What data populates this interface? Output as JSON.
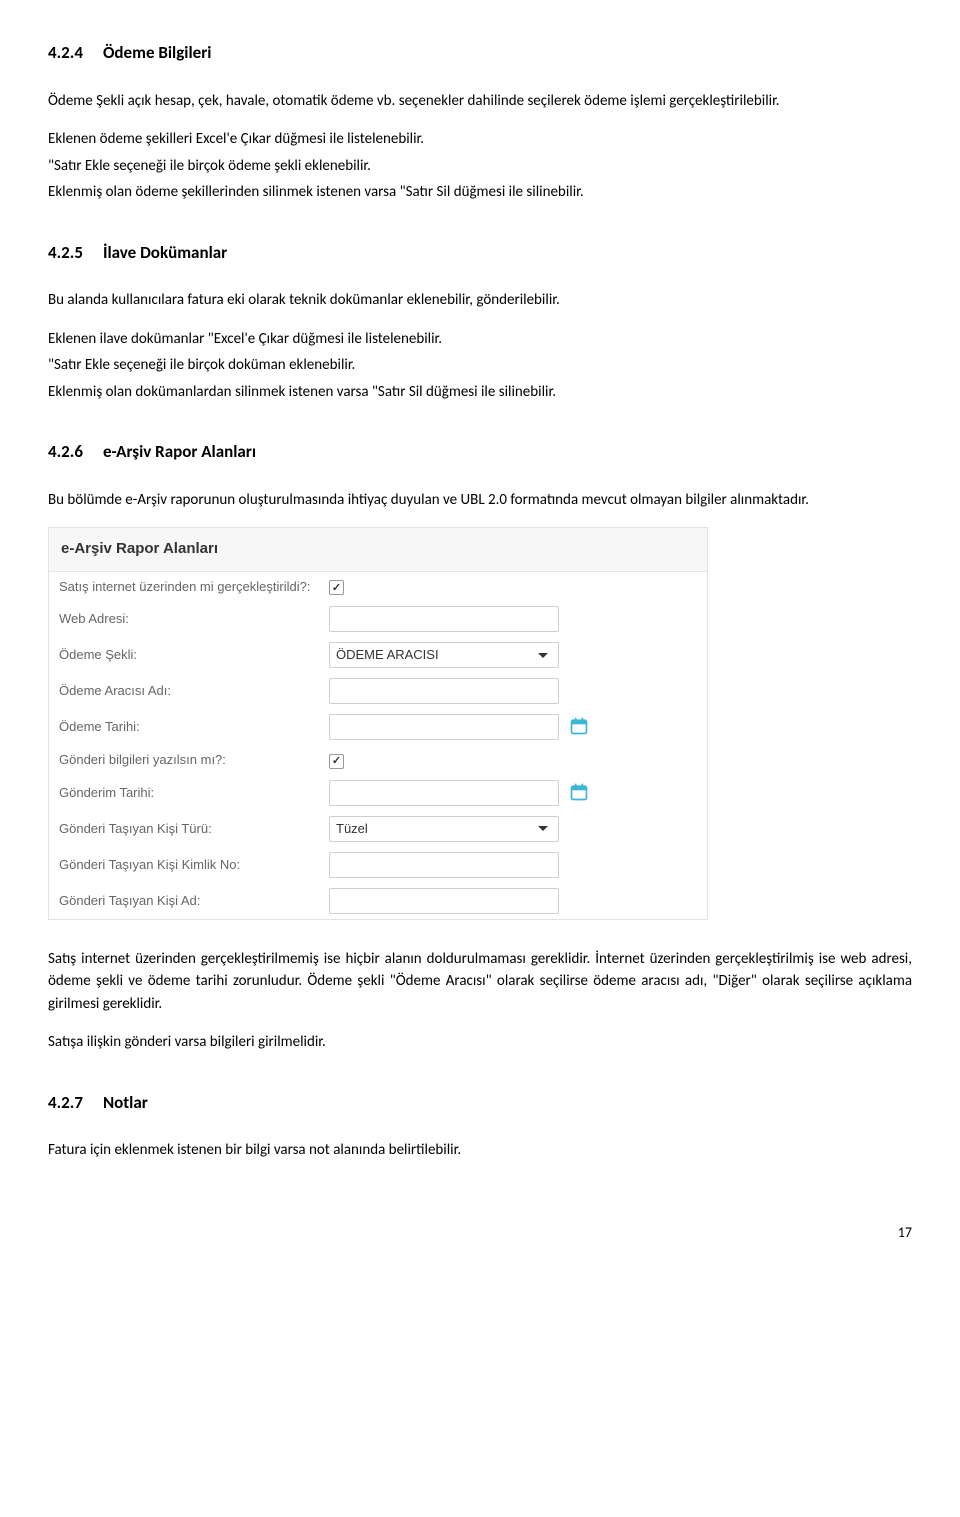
{
  "sections": {
    "s424": {
      "num": "4.2.4",
      "title": "Ödeme Bilgileri"
    },
    "s425": {
      "num": "4.2.5",
      "title": "İlave Dokümanlar"
    },
    "s426": {
      "num": "4.2.6",
      "title": "e-Arşiv Rapor Alanları"
    },
    "s427": {
      "num": "4.2.7",
      "title": "Notlar"
    }
  },
  "para": {
    "p424_1": "Ödeme Şekli açık hesap, çek, havale, otomatik ödeme vb. seçenekler dahilinde seçilerek ödeme işlemi gerçekleştirilebilir.",
    "p424_2": "Eklenen ödeme şekilleri Excel'e Çıkar düğmesi ile listelenebilir.",
    "p424_3": "\"Satır Ekle seçeneği ile birçok ödeme şekli eklenebilir.",
    "p424_4": "Eklenmiş olan ödeme şekillerinden silinmek istenen varsa \"Satır Sil düğmesi ile silinebilir.",
    "p425_1": "Bu alanda kullanıcılara  fatura eki olarak teknik  dokümanlar eklenebilir, gönderilebilir.",
    "p425_2": "Eklenen ilave dokümanlar \"Excel'e Çıkar düğmesi ile listelenebilir.",
    "p425_3": "\"Satır Ekle seçeneği ile birçok doküman eklenebilir.",
    "p425_4": "Eklenmiş olan dokümanlardan silinmek istenen varsa \"Satır Sil düğmesi ile silinebilir.",
    "p426_1": "Bu bölümde e-Arşiv raporunun oluşturulmasında ihtiyaç duyulan ve UBL 2.0 formatında mevcut olmayan bilgiler alınmaktadır.",
    "p426_2": "Satış internet üzerinden gerçekleştirilmemiş ise hiçbir alanın doldurulmaması gereklidir. İnternet üzerinden gerçekleştirilmiş ise web adresi, ödeme şekli ve ödeme tarihi zorunludur. Ödeme şekli \"Ödeme Aracısı\" olarak seçilirse ödeme aracısı adı, \"Diğer\" olarak seçilirse açıklama girilmesi gereklidir.",
    "p426_3": "Satışa ilişkin gönderi varsa bilgileri girilmelidir.",
    "p427_1": "Fatura için eklenmek istenen bir bilgi varsa not alanında belirtilebilir."
  },
  "form": {
    "header": "e-Arşiv Rapor Alanları",
    "rows": {
      "internet": {
        "label": "Satış internet üzerinden mi gerçekleştirildi?:",
        "checked": true
      },
      "web": {
        "label": "Web Adresi:"
      },
      "odeme_sekli": {
        "label": "Ödeme Şekli:",
        "value": "ÖDEME ARACISI"
      },
      "araci_adi": {
        "label": "Ödeme Aracısı Adı:"
      },
      "odeme_tarihi": {
        "label": "Ödeme Tarihi:"
      },
      "gonderi_yazilsin": {
        "label": "Gönderi bilgileri yazılsın mı?:",
        "checked": true
      },
      "gonderim_tarihi": {
        "label": "Gönderim Tarihi:"
      },
      "tasiyan_turu": {
        "label": "Gönderi Taşıyan Kişi Türü:",
        "value": "Tüzel"
      },
      "tasiyan_kimlik": {
        "label": "Gönderi Taşıyan Kişi Kimlik No:"
      },
      "tasiyan_ad": {
        "label": "Gönderi Taşıyan Kişi Ad:"
      }
    }
  },
  "page_number": "17"
}
